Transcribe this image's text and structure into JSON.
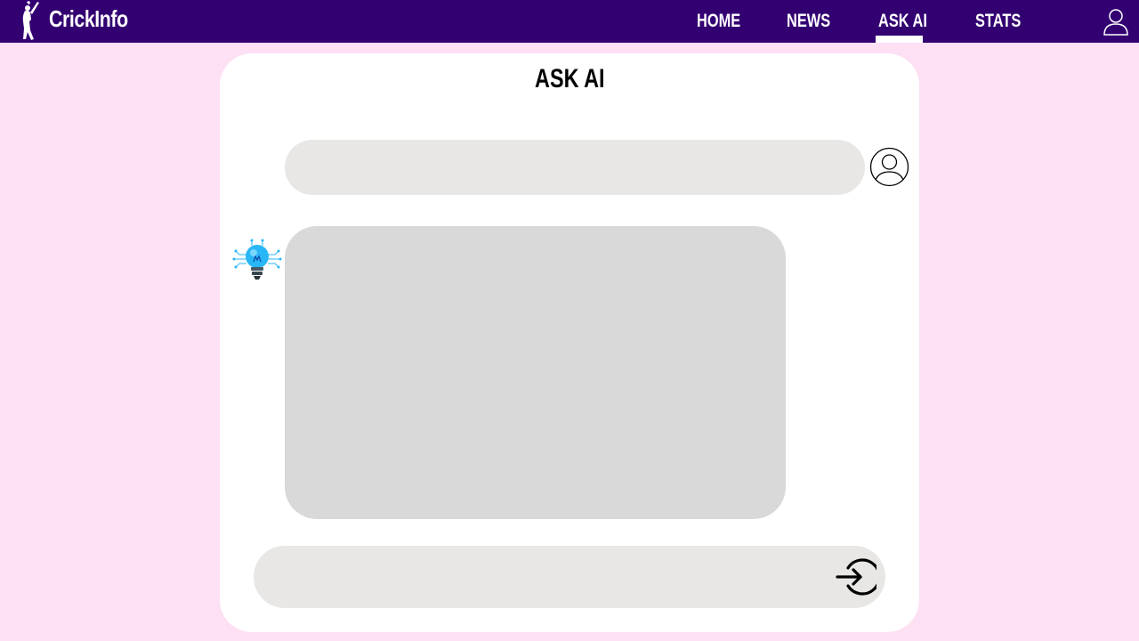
{
  "brand": {
    "name": "CrickInfo",
    "logo_icon": "batsman-icon"
  },
  "nav": {
    "items": [
      {
        "label": "HOME"
      },
      {
        "label": "NEWS"
      },
      {
        "label": "ASK AI",
        "active": true
      },
      {
        "label": "STATS"
      }
    ],
    "profile_icon": "user-icon"
  },
  "chat": {
    "title": "ASK AI",
    "user_message": "",
    "user_avatar_icon": "user-circle-icon",
    "ai_icon": "lightbulb-circuit-icon",
    "ai_response": "",
    "input": {
      "value": "",
      "placeholder": ""
    },
    "send_icon": "login-arrow-icon"
  },
  "colors": {
    "page_background": "#fde0f3",
    "navbar": "#330072",
    "card": "#ffffff",
    "user_bubble": "#e8e7e5",
    "ai_bubble": "#d9d9d9",
    "input_bar": "#e8e7e5",
    "ai_icon_accent": "#29b6f6"
  }
}
